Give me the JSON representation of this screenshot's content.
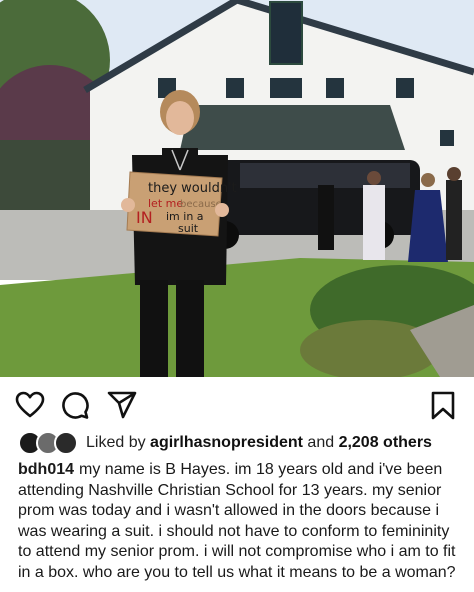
{
  "post": {
    "photo": {
      "alt": "photo",
      "sign": {
        "line1": "they wouldn't",
        "line2": "let me",
        "line3": "because",
        "line4": "IN",
        "line5": "im in a",
        "line6": "suit"
      }
    },
    "actions": {
      "like_icon": "heart-icon",
      "comment_icon": "comment-bubble-icon",
      "share_icon": "paper-plane-icon",
      "save_icon": "bookmark-icon"
    },
    "likes": {
      "prefix": "Liked by ",
      "user": "agirlhasnopresident",
      "middle": " and ",
      "count": "2,208 others"
    },
    "caption": {
      "username": "bdh014",
      "text": "my name is B Hayes. im 18 years old and i've been attending Nashville Christian School for 13 years. my senior prom was today and i wasn't allowed in the doors because i was wearing a suit. i should not have to conform to femininity to attend my senior prom. i will not compromise who i am to fit in a box. who are you to tell us what it means to be a woman?"
    }
  }
}
